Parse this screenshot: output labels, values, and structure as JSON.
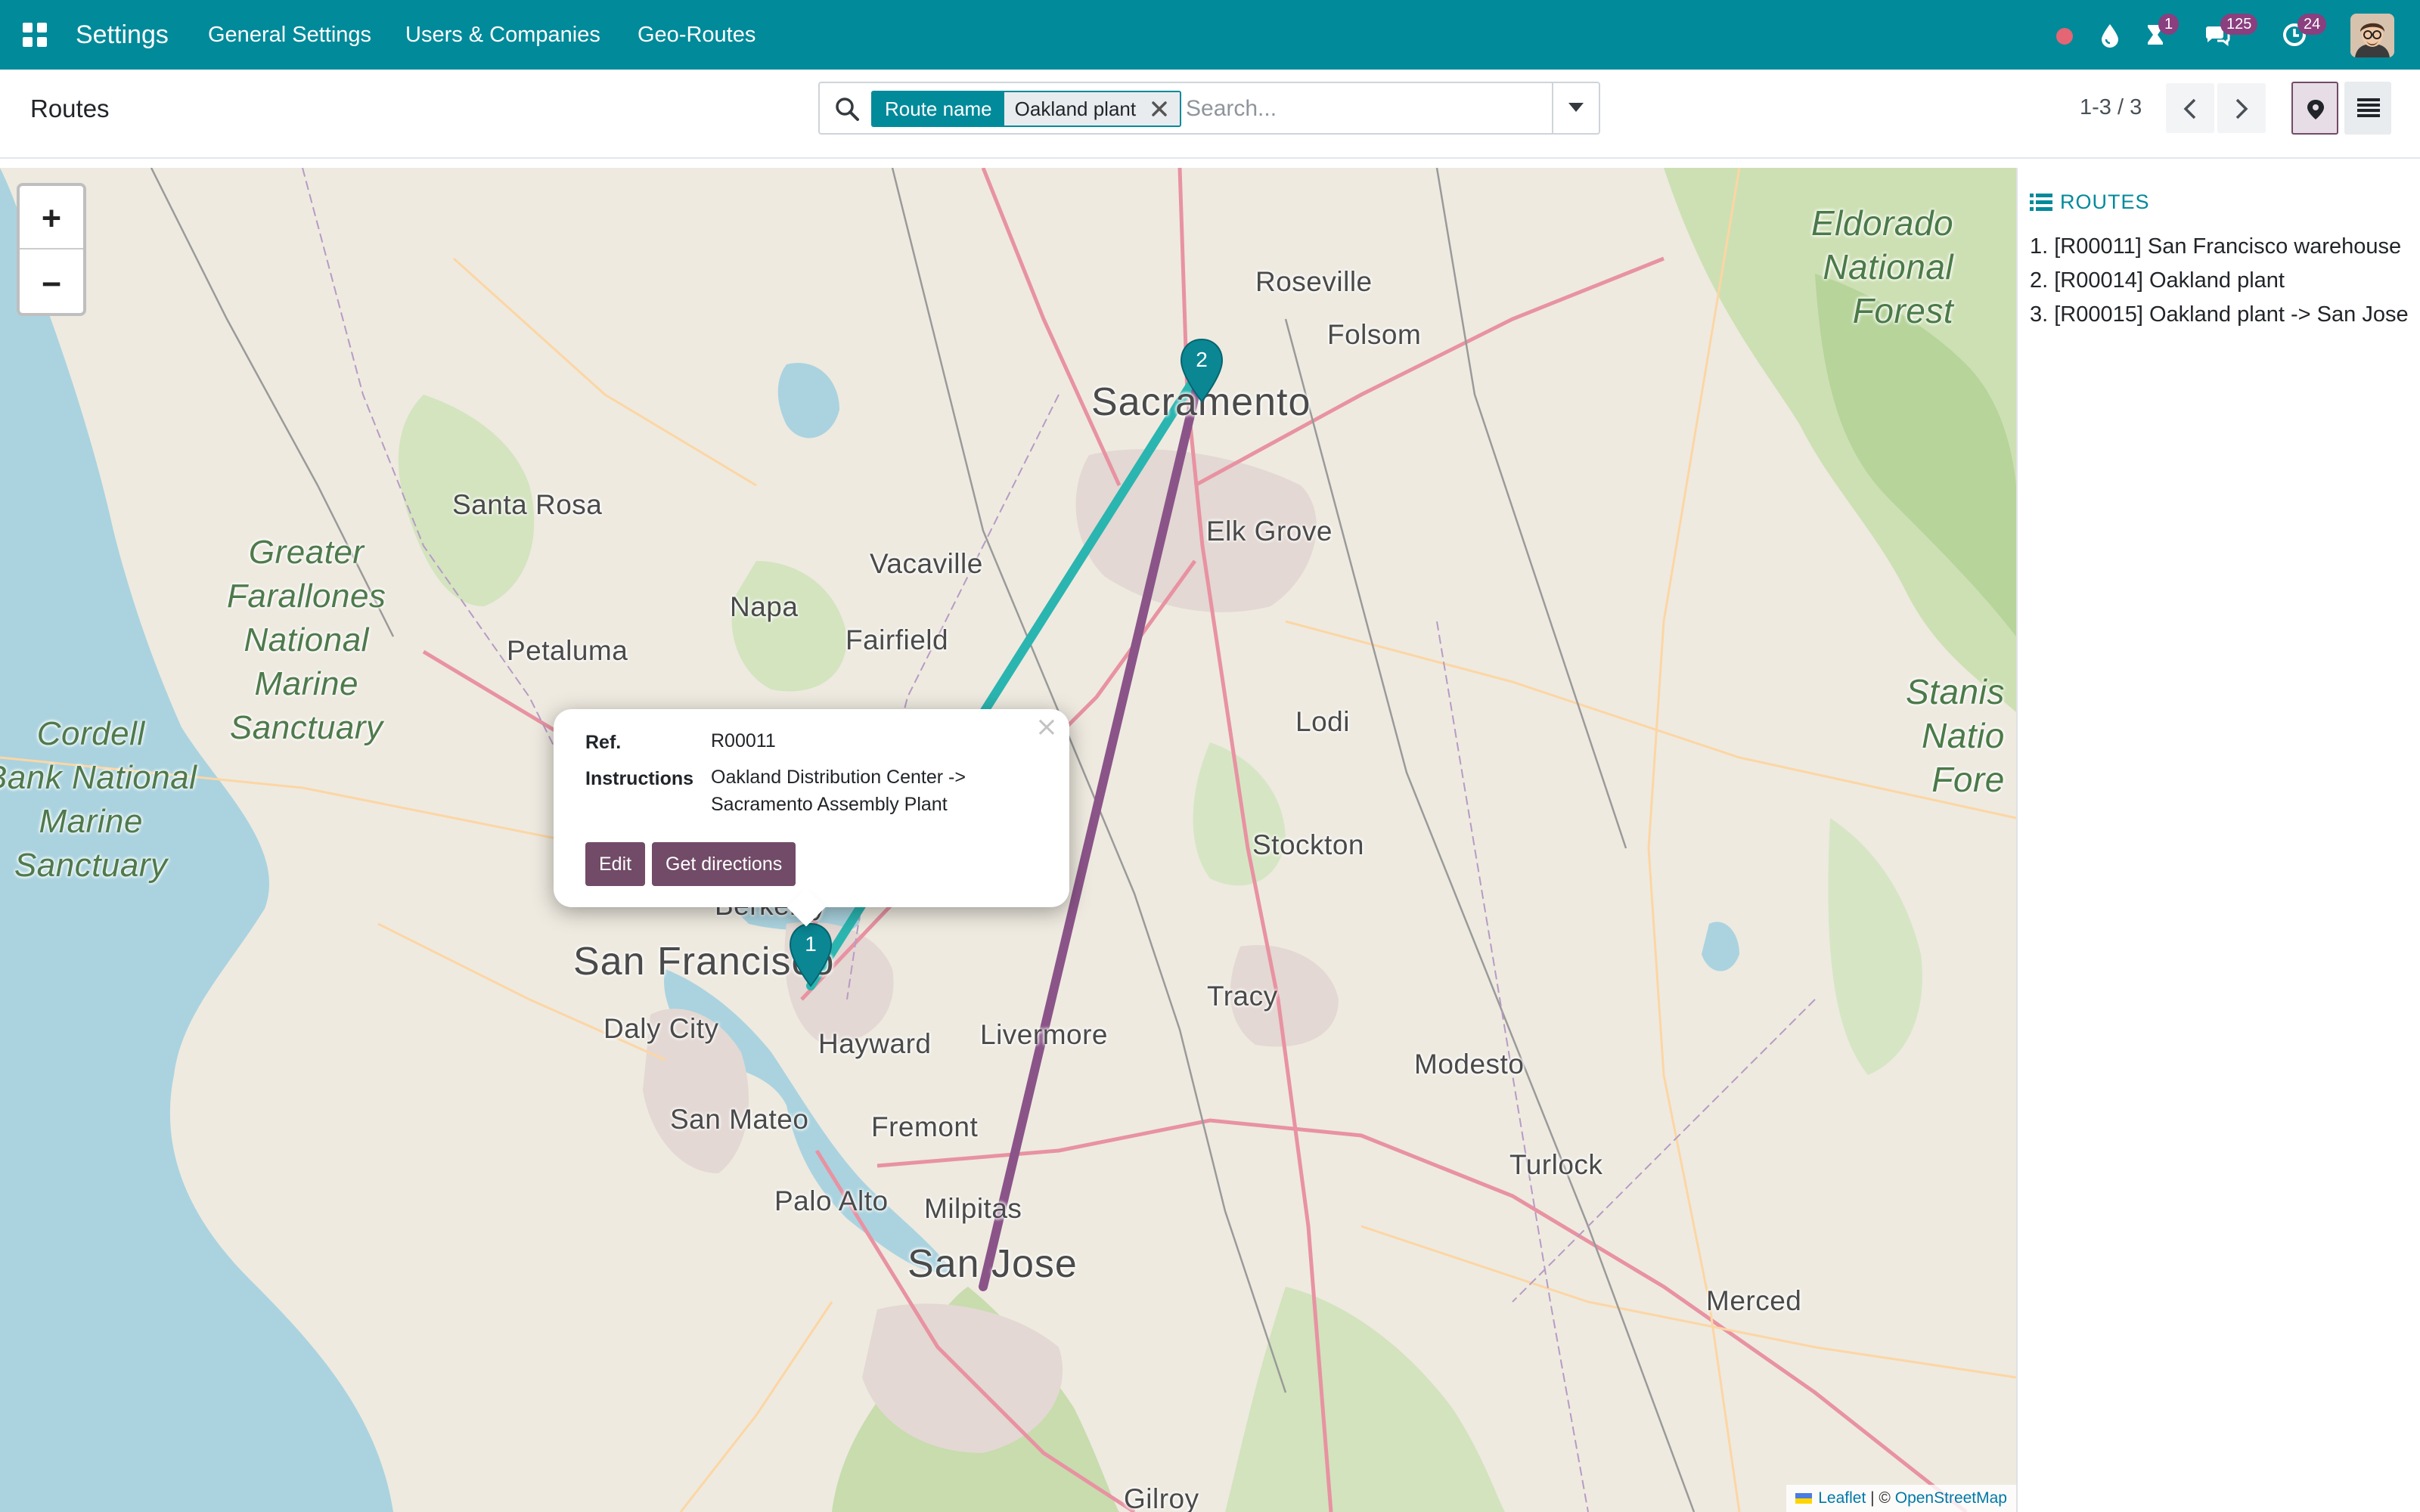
{
  "navbar": {
    "app_name": "Settings",
    "menu": [
      "General Settings",
      "Users & Companies",
      "Geo-Routes"
    ],
    "activity_badge": "1",
    "messages_badge": "125",
    "clock_badge": "24",
    "bg_color": "#018a9a",
    "badge_color": "#8a3f7f"
  },
  "control": {
    "title": "Routes",
    "facet_label": "Route name",
    "facet_value": "Oakland plant",
    "search_placeholder": "Search...",
    "pager": "1-3 / 3"
  },
  "map": {
    "places": {
      "roseville": "Roseville",
      "folsom": "Folsom",
      "sacramento": "Sacramento",
      "santa_rosa": "Santa Rosa",
      "elk_grove": "Elk Grove",
      "vacaville": "Vacaville",
      "napa": "Napa",
      "fairfield": "Fairfield",
      "petaluma": "Petaluma",
      "lodi": "Lodi",
      "stockton": "Stockton",
      "berkeley": "Berkeley",
      "san_francisco": "San Francisco",
      "daly_city": "Daly City",
      "hayward": "Hayward",
      "livermore": "Livermore",
      "tracy": "Tracy",
      "modesto": "Modesto",
      "san_mateo": "San Mateo",
      "fremont": "Fremont",
      "turlock": "Turlock",
      "palo_alto": "Palo Alto",
      "milpitas": "Milpitas",
      "san_jose": "San Jose",
      "merced": "Merced",
      "gilroy": "Gilroy"
    },
    "green_areas": {
      "farallones": "Greater\nFarallones\nNational\nMarine\nSanctuary",
      "cordell": "Cordell\nBank National\nMarine\nSanctuary",
      "eldorado": "Eldorado\nNational\nForest",
      "stanislaus": "Stanis\nNatio\nFore"
    },
    "markers": [
      "1",
      "2"
    ],
    "route_colors": {
      "teal": "#2bb5b0",
      "purple": "#8b5489"
    },
    "popup": {
      "ref_label": "Ref.",
      "ref_value": "R00011",
      "instructions_label": "Instructions",
      "instructions_value": "Oakland Distribution Center -> Sacramento Assembly Plant",
      "edit_label": "Edit",
      "directions_label": "Get directions",
      "close_label": "×"
    },
    "zoom_in": "+",
    "zoom_out": "−",
    "attribution": {
      "leaflet": "Leaflet",
      "separator": " | © ",
      "osm": "OpenStreetMap"
    }
  },
  "panel": {
    "heading": "ROUTES",
    "routes": [
      "1. [R00011] San Francisco warehouse",
      "2. [R00014] Oakland plant",
      "3. [R00015] Oakland plant -> San Jose"
    ]
  }
}
